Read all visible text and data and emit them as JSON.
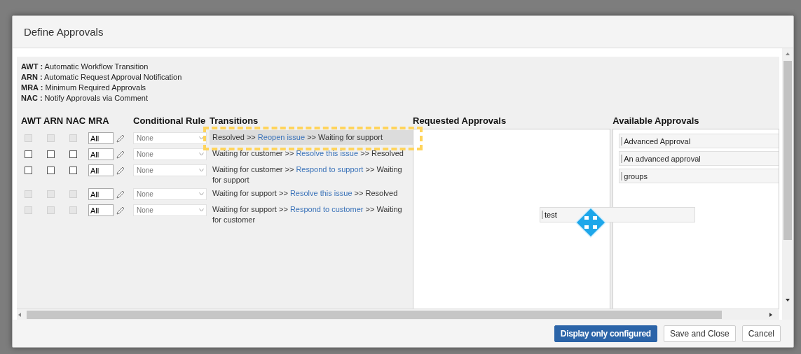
{
  "dialog": {
    "title": "Define Approvals"
  },
  "legend": [
    {
      "abbr": "AWT :",
      "text": "Automatic Workflow Transition"
    },
    {
      "abbr": "ARN :",
      "text": "Automatic Request Approval Notification"
    },
    {
      "abbr": "MRA :",
      "text": "Minimum Required Approvals"
    },
    {
      "abbr": "NAC :",
      "text": "Notify Approvals via Comment"
    }
  ],
  "columns": [
    "AWT",
    "ARN",
    "NAC",
    "MRA",
    "Conditional Rule",
    "Transitions"
  ],
  "rows": [
    {
      "disabled": true,
      "dragging": true,
      "mra": "All",
      "rule": "None",
      "transition": [
        {
          "kind": "plain",
          "text": "Resolved >> "
        },
        {
          "kind": "link",
          "text": "Reopen issue"
        },
        {
          "kind": "plain",
          "text": " >> Waiting for support"
        }
      ]
    },
    {
      "disabled": false,
      "dragging": false,
      "mra": "All",
      "rule": "None",
      "transition": [
        {
          "kind": "plain",
          "text": "Waiting for customer >> "
        },
        {
          "kind": "link",
          "text": "Resolve this issue"
        },
        {
          "kind": "plain",
          "text": " >> Resolved"
        }
      ]
    },
    {
      "disabled": false,
      "dragging": false,
      "mra": "All",
      "rule": "None",
      "transition": [
        {
          "kind": "plain",
          "text": "Waiting for customer >> "
        },
        {
          "kind": "link",
          "text": "Respond to support"
        },
        {
          "kind": "plain",
          "text": " >> Waiting for support"
        }
      ]
    },
    {
      "disabled": true,
      "dragging": false,
      "mra": "All",
      "rule": "None",
      "transition": [
        {
          "kind": "plain",
          "text": "Waiting for support >> "
        },
        {
          "kind": "link",
          "text": "Resolve this issue"
        },
        {
          "kind": "plain",
          "text": " >> Resolved"
        }
      ]
    },
    {
      "disabled": true,
      "dragging": false,
      "mra": "All",
      "rule": "None",
      "transition": [
        {
          "kind": "plain",
          "text": "Waiting for support >> "
        },
        {
          "kind": "link",
          "text": "Respond to customer"
        },
        {
          "kind": "plain",
          "text": " >> Waiting for customer"
        }
      ]
    }
  ],
  "requested": {
    "title": "Requested Approvals"
  },
  "available": {
    "title": "Available Approvals",
    "items": [
      "Advanced Approval",
      "An advanced approval",
      "groups"
    ]
  },
  "drag_ghost": {
    "label": "test"
  },
  "buttons": [
    {
      "label": "Display only configured",
      "primary": true
    },
    {
      "label": "Save and Close",
      "primary": false
    },
    {
      "label": "Cancel",
      "primary": false
    }
  ]
}
